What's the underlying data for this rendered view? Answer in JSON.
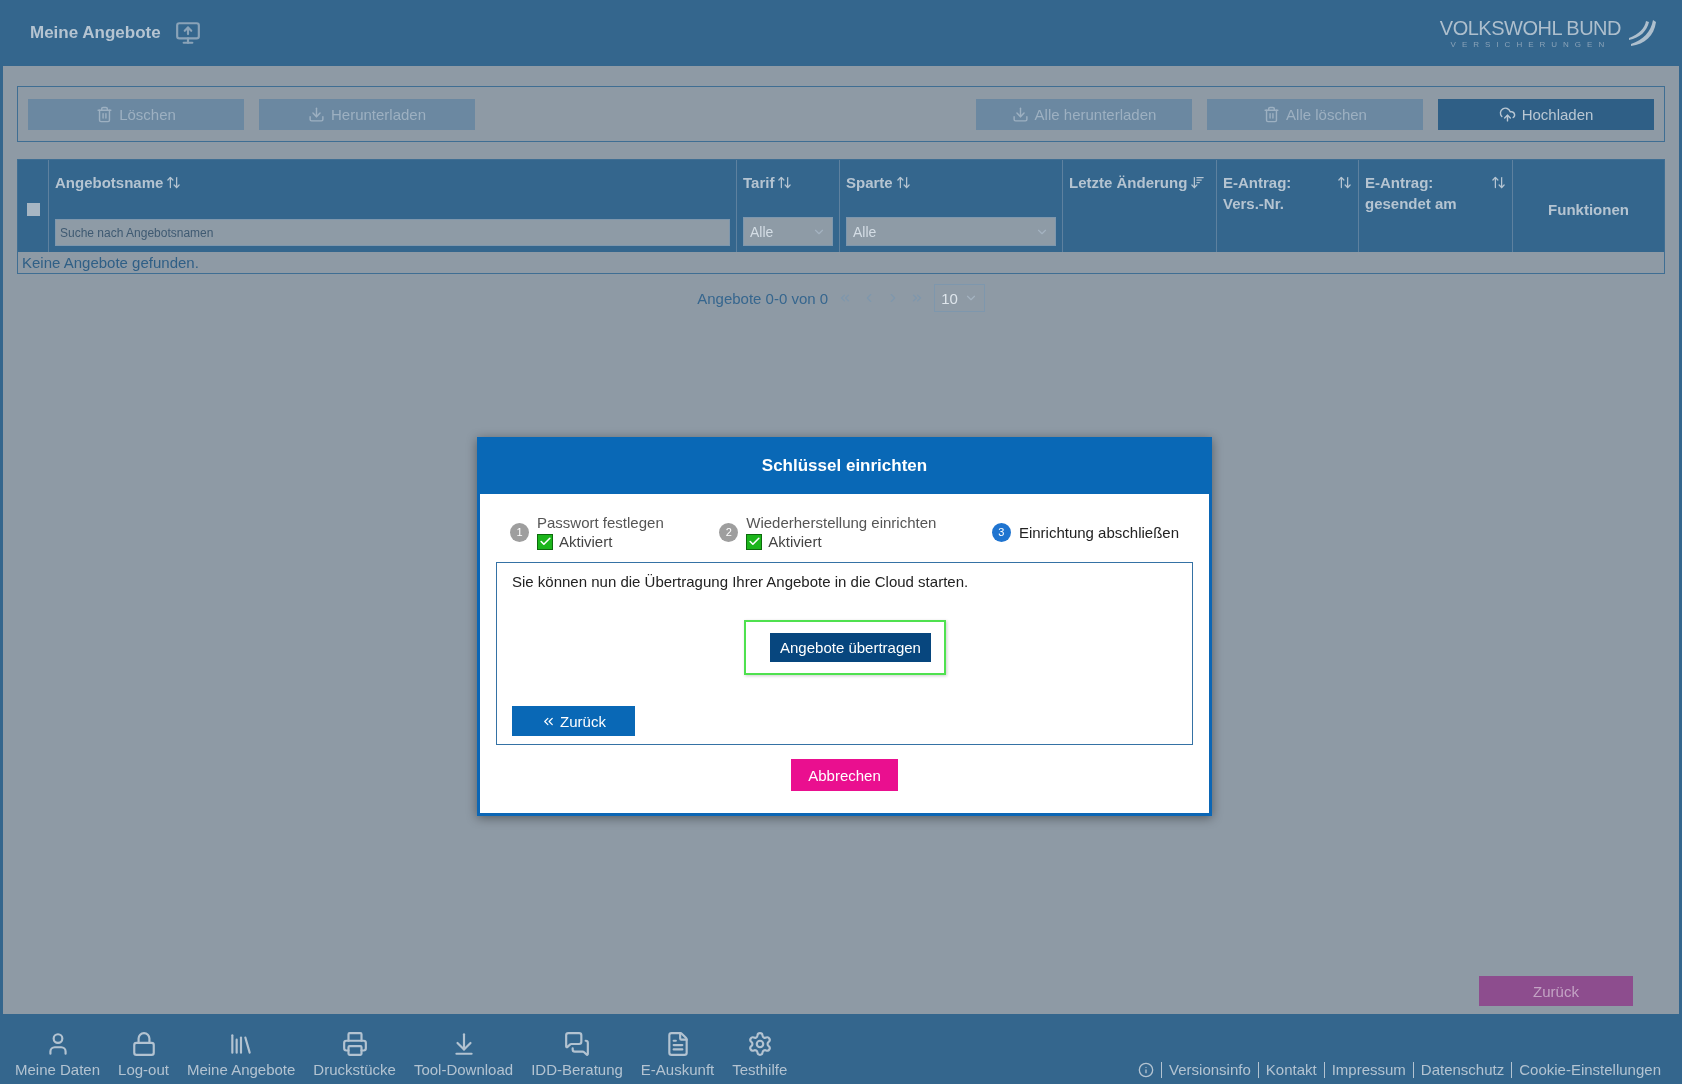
{
  "header": {
    "title": "Meine Angebote",
    "logo_name": "VOLKSWOHL BUND",
    "logo_sub": "VERSICHERUNGEN"
  },
  "toolbar": {
    "left": [
      {
        "label": "Löschen",
        "disabled": true
      },
      {
        "label": "Herunterladen",
        "disabled": true
      }
    ],
    "right": [
      {
        "label": "Alle herunterladen",
        "disabled": true
      },
      {
        "label": "Alle löschen",
        "disabled": true
      },
      {
        "label": "Hochladen",
        "disabled": false
      }
    ]
  },
  "table": {
    "select_all": {
      "checked": false
    },
    "columns": [
      {
        "label": "Angebotsname",
        "filter": {
          "kind": "text",
          "placeholder": "Suche nach Angebotsnamen"
        }
      },
      {
        "label": "Tarif",
        "filter": {
          "kind": "select",
          "value": "Alle"
        }
      },
      {
        "label": "Sparte",
        "filter": {
          "kind": "select",
          "value": "Alle"
        }
      },
      {
        "label": "Letzte Änderung"
      },
      {
        "label": "E-Antrag: Vers.-Nr."
      },
      {
        "label": "E-Antrag: gesendet am"
      },
      {
        "label": "Funktionen"
      }
    ],
    "empty_message": "Keine Angebote gefunden."
  },
  "pagination": {
    "summary": "Angebote 0-0 von 0",
    "page_size": "10"
  },
  "modal": {
    "title": "Schlüssel einrichten",
    "steps": [
      {
        "number": "1",
        "label": "Passwort festlegen",
        "selected": false,
        "checked": true,
        "status": "Aktiviert"
      },
      {
        "number": "2",
        "label": "Wiederherstellung einrichten",
        "selected": false,
        "checked": true,
        "status": "Aktiviert"
      },
      {
        "number": "3",
        "label": "Einrichtung abschließen",
        "selected": true,
        "checked": false
      }
    ],
    "message": "Sie können nun die Übertragung Ihrer Angebote in die Cloud starten.",
    "primary_button": "Angebote übertragen",
    "back_button": "Zurück",
    "cancel_button": "Abbrechen"
  },
  "back_button": "Zurück",
  "footer": {
    "nav": [
      "Meine Daten",
      "Log-out",
      "Meine Angebote",
      "Druckstücke",
      "Tool-Download",
      "IDD-Beratung",
      "E-Auskunft",
      "Testhilfe"
    ],
    "links": [
      "Versionsinfo",
      "Kontakt",
      "Impressum",
      "Datenschutz",
      "Cookie-Einstellungen"
    ]
  }
}
